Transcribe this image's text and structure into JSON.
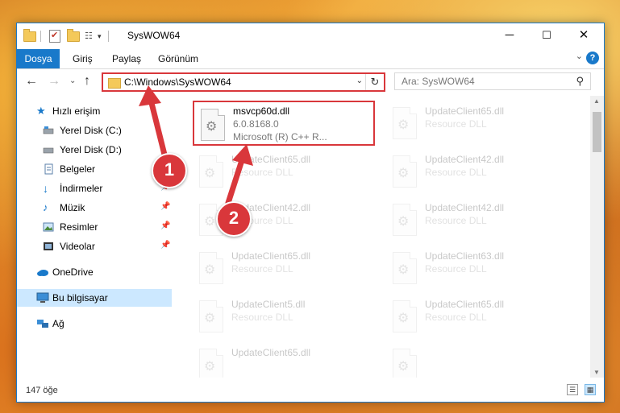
{
  "window": {
    "title": "SysWOW64",
    "minimize": "─",
    "maximize": "☐",
    "close": "✕"
  },
  "ribbon": {
    "tabs": [
      "Dosya",
      "Giriş",
      "Paylaş",
      "Görünüm"
    ],
    "expand": "⌄",
    "help": "?"
  },
  "nav": {
    "back": "←",
    "forward": "→",
    "recent": "⌄",
    "up": "↑",
    "address": "C:\\Windows\\SysWOW64",
    "address_dropdown": "⌄",
    "refresh": "↻",
    "search_placeholder": "Ara: SysWOW64",
    "search_icon": "⚲"
  },
  "sidebar": {
    "items": [
      {
        "label": "Hızlı erişim",
        "icon": "star-icon"
      },
      {
        "label": "Yerel Disk (C:)",
        "icon": "drive-icon"
      },
      {
        "label": "Yerel Disk (D:)",
        "icon": "drive-icon"
      },
      {
        "label": "Belgeler",
        "icon": "documents-icon"
      },
      {
        "label": "İndirmeler",
        "icon": "download-icon"
      },
      {
        "label": "Müzik",
        "icon": "music-icon"
      },
      {
        "label": "Resimler",
        "icon": "pictures-icon"
      },
      {
        "label": "Videolar",
        "icon": "videos-icon"
      },
      {
        "label": "OneDrive",
        "icon": "cloud-icon"
      },
      {
        "label": "Bu bilgisayar",
        "icon": "computer-icon"
      },
      {
        "label": "Ağ",
        "icon": "network-icon"
      }
    ]
  },
  "files": {
    "highlighted": {
      "name": "msvcp60d.dll",
      "version": "6.0.8168.0",
      "company": "Microsoft (R) C++ R..."
    },
    "others": [
      {
        "name": "UpdateClient65.dll",
        "desc": "Resource DLL"
      },
      {
        "name": "UpdateClient42.dll",
        "desc": "Resource DLL"
      },
      {
        "name": "UpdateClient65.dll",
        "desc": "Resource DLL"
      },
      {
        "name": "UpdateClient42.dll",
        "desc": "Resource DLL"
      },
      {
        "name": "UpdateClient65.dll",
        "desc": "Resource DLL"
      },
      {
        "name": "UpdateClient42.dll",
        "desc": "Resource DLL"
      },
      {
        "name": "UpdateClient65.dll",
        "desc": "Resource DLL"
      },
      {
        "name": "UpdateClient63.dll",
        "desc": "Resource DLL"
      },
      {
        "name": "UpdateClient5.dll",
        "desc": "Resource DLL"
      },
      {
        "name": "UpdateClient65.dll",
        "desc": "Resource DLL"
      }
    ]
  },
  "status": {
    "count": "147 öğe"
  },
  "annotations": {
    "step1": "1",
    "step2": "2",
    "color": "#d9373b"
  }
}
